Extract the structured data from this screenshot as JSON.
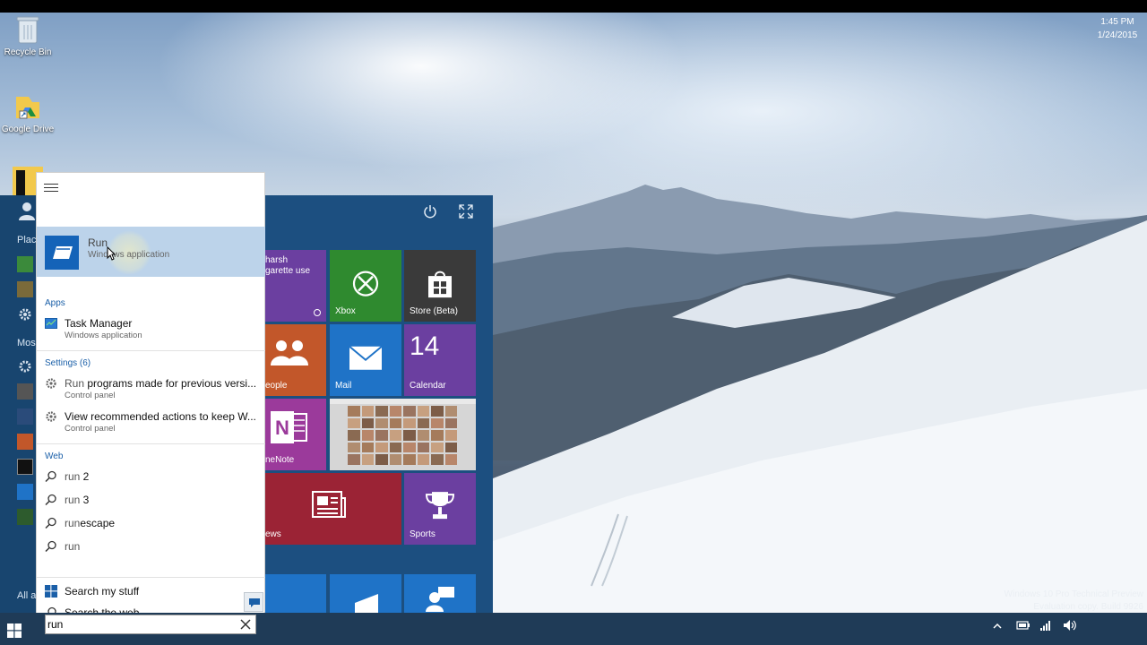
{
  "desktop": {
    "icons": [
      {
        "label": "Recycle Bin",
        "icon": "recycle-bin-icon"
      },
      {
        "label": "Google Drive",
        "icon": "google-drive-icon"
      }
    ],
    "watermark": {
      "line1": "Windows 10 Pro Technical Preview",
      "line2": "Evaluation copy. Build 9926"
    }
  },
  "start": {
    "left_labels": {
      "places": "Plac",
      "most_used": "Mos",
      "all_apps": "All a"
    },
    "tiles": {
      "live_text_line1": "harsh",
      "live_text_line2": "garette use",
      "xbox": "Xbox",
      "store": "Store (Beta)",
      "people": "eople",
      "mail": "Mail",
      "calendar": "Calendar",
      "calendar_day": "14",
      "onenote": "neNote",
      "news": "ews",
      "sports": "Sports"
    }
  },
  "search": {
    "best_match": {
      "title": "Run",
      "subtitle": "Windows application"
    },
    "apps_header": "Apps",
    "apps": [
      {
        "title": "Task Manager",
        "subtitle": "Windows application"
      }
    ],
    "settings_header": "Settings (6)",
    "settings": [
      {
        "title_bold": "Run",
        "title_rest": " programs made for previous versi...",
        "subtitle": "Control panel"
      },
      {
        "title_bold": "View recommended actions to keep W...",
        "title_rest": "",
        "subtitle": "Control panel"
      }
    ],
    "web_header": "Web",
    "web": [
      {
        "prefix": "run",
        "suffix": " 2"
      },
      {
        "prefix": "run",
        "suffix": " 3"
      },
      {
        "prefix": "run",
        "suffix": "escape"
      },
      {
        "prefix": "run",
        "suffix": ""
      }
    ],
    "search_my_stuff": "Search my stuff",
    "search_the_web": "Search the web",
    "query": "run"
  },
  "taskbar": {
    "time": "1:45 PM",
    "date": "1/24/2015"
  },
  "colors": {
    "start_bg": "#1c4f80",
    "best_match_bg": "#bcd3ea",
    "accent_blue": "#1a5fa8",
    "tile_purple": "#6b3fa0",
    "tile_green": "#2f8a2f",
    "tile_dark": "#3a3a3a",
    "tile_orange": "#c2572a",
    "tile_blue": "#1f73c7",
    "tile_red": "#9b2335"
  }
}
